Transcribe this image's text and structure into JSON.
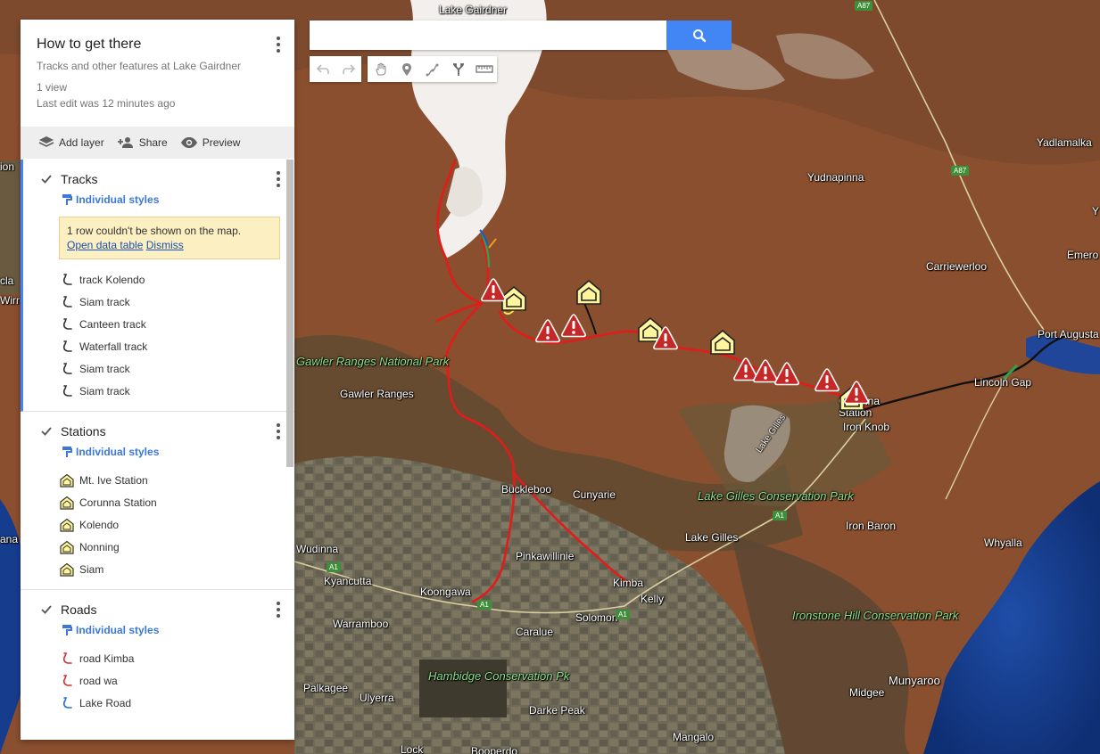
{
  "panel": {
    "title": "How to get there",
    "description": "Tracks and other features at Lake Gairdner",
    "views": "1 view",
    "last_edit": "Last edit was 12 minutes ago",
    "actions": {
      "add_layer": "Add layer",
      "share": "Share",
      "preview": "Preview"
    }
  },
  "layers": {
    "tracks": {
      "name": "Tracks",
      "style": "Individual styles",
      "warning_text": "1 row couldn't be shown on the map.",
      "warning_open": "Open data table",
      "warning_dismiss": "Dismiss",
      "items": [
        "track Kolendo",
        "Siam track",
        "Canteen track",
        "Waterfall track",
        "Siam track",
        "Siam track"
      ]
    },
    "stations": {
      "name": "Stations",
      "style": "Individual styles",
      "items": [
        "Mt. Ive Station",
        "Corunna Station",
        "Kolendo",
        "Nonning",
        "Siam"
      ]
    },
    "roads": {
      "name": "Roads",
      "style": "Individual styles",
      "items": [
        "road Kimba",
        "road wa",
        "Lake Road"
      ]
    }
  },
  "search": {
    "placeholder": ""
  },
  "toolbar": {
    "icons": [
      "undo-icon",
      "redo-icon",
      "hand-icon",
      "marker-icon",
      "draw-line-icon",
      "directions-icon",
      "ruler-icon"
    ]
  },
  "map": {
    "places": {
      "lake_gairdner": "Lake Gairdner",
      "yadlamalka": "Yadlamalka",
      "yudnapinna": "Yudnapinna",
      "carriewerloo": "Carriewerloo",
      "emeroo": "Emero",
      "port_augusta": "Port Augusta",
      "lincoln_gap": "Lincoln Gap",
      "gawler_np": "Gawler Ranges National Park",
      "gawler_ranges": "Gawler Ranges",
      "corunna_station": "Corunna Station",
      "iron_knob": "Iron Knob",
      "buckleboo": "Buckleboo",
      "cunyarie": "Cunyarie",
      "lake_gilles_cp": "Lake Gilles Conservation Park",
      "lake_gilles_town": "Lake Gilles",
      "lake_gilles_lake": "Lake Gilles",
      "iron_baron": "Iron Baron",
      "whyalla": "Whyalla",
      "wudinna": "Wudinna",
      "pinkawillinie": "Pinkawillinie",
      "kyancutta": "Kyancutta",
      "koongawa": "Koongawa",
      "kimba": "Kimba",
      "kelly": "Kelly",
      "solomon": "Solomon",
      "warramboo": "Warramboo",
      "caralue": "Caralue",
      "ironstone_hill": "Ironstone Hill Conservation Park",
      "hambidge": "Hambidge Conservation Pk",
      "palkagee": "Palkagee",
      "ulyerra": "Ulyerra",
      "darke_peak": "Darke Peak",
      "midgee": "Midgee",
      "munyaroo": "Munyaroo",
      "mangalo": "Mangalo",
      "lock": "Lock",
      "booperdo": "Booperdo",
      "edge_ion": "ion",
      "edge_cla": "cla",
      "edge_wirru": "Wirru",
      "edge_ana": "ana",
      "edge_y": "Y"
    },
    "shields": {
      "a87": "A87",
      "a1": "A1"
    },
    "colors": {
      "track": "#e21b1b",
      "road_black": "#111111",
      "station_fill": "#fff59d",
      "hazard": "#c62828"
    }
  }
}
